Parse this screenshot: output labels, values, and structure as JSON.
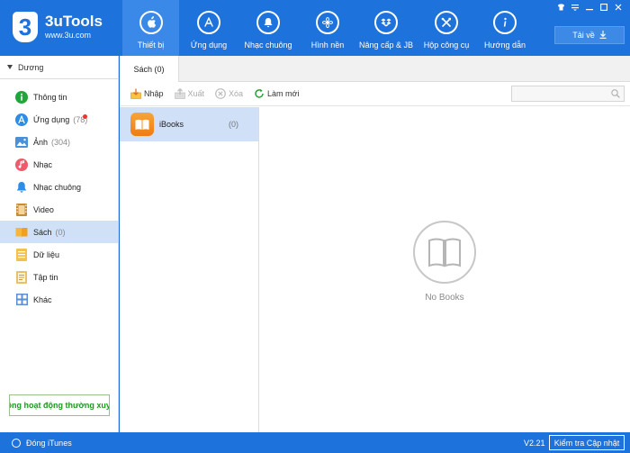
{
  "brand": {
    "title": "3uTools",
    "url": "www.3u.com",
    "badge": "3"
  },
  "nav": [
    {
      "label": "Thiết bị",
      "icon": "apple-icon",
      "active": true
    },
    {
      "label": "Ứng dụng",
      "icon": "app-store-icon"
    },
    {
      "label": "Nhạc chuông",
      "icon": "bell-icon"
    },
    {
      "label": "Hình nền",
      "icon": "flower-icon"
    },
    {
      "label": "Nâng cấp & JB",
      "icon": "dropbox-icon"
    },
    {
      "label": "Hộp công cụ",
      "icon": "tools-icon"
    },
    {
      "label": "Hướng dẫn",
      "icon": "info-icon"
    }
  ],
  "download_label": "Tải về",
  "window_controls": [
    "shirt",
    "menu",
    "minimize",
    "maximize",
    "close"
  ],
  "device": {
    "name": "Dương"
  },
  "sidebar": [
    {
      "label": "Thông tin",
      "count": "",
      "icon": "info-circle-icon"
    },
    {
      "label": "Ứng dụng",
      "count": "(78)",
      "icon": "app-store-circle-icon",
      "badge": true
    },
    {
      "label": "Ảnh",
      "count": "(304)",
      "icon": "photo-icon"
    },
    {
      "label": "Nhạc",
      "count": "",
      "icon": "music-icon"
    },
    {
      "label": "Nhạc chuông",
      "count": "",
      "icon": "bell-icon"
    },
    {
      "label": "Video",
      "count": "",
      "icon": "film-icon"
    },
    {
      "label": "Sách",
      "count": "(0)",
      "icon": "book-icon",
      "active": true
    },
    {
      "label": "Dữ liệu",
      "count": "",
      "icon": "data-icon"
    },
    {
      "label": "Tập tin",
      "count": "",
      "icon": "file-icon"
    },
    {
      "label": "Khác",
      "count": "",
      "icon": "grid-icon"
    }
  ],
  "marquee_text": "hông hoạt động thường xuyên",
  "tab": {
    "label": "Sách (0)"
  },
  "toolbar": {
    "import": "Nhập",
    "export": "Xuất",
    "delete": "Xóa",
    "refresh": "Làm mới"
  },
  "search": {
    "placeholder": ""
  },
  "book_sources": [
    {
      "name": "iBooks",
      "count": "(0)"
    }
  ],
  "empty_state": {
    "text": "No Books"
  },
  "status": {
    "itunes_label": "Đóng iTunes",
    "version": "V2.21",
    "update_label": "Kiểm tra Cập nhật"
  },
  "colors": {
    "brand_blue": "#1e72dc",
    "active_nav": "#3a89e8",
    "selection": "#cfe0f7",
    "marquee_green": "#1c9a20"
  }
}
